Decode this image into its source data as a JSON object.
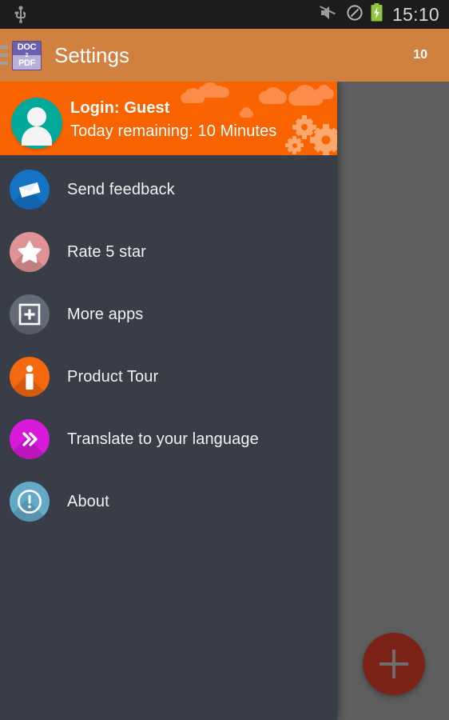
{
  "status_bar": {
    "usb_icon": "usb-icon",
    "mute_icon": "volume-muted-icon",
    "dnd_icon": "do-not-disturb-icon",
    "battery_icon": "battery-charging-icon",
    "clock": "15:10",
    "background": "#1c1c1c",
    "text_color": "#d8d8d8"
  },
  "action_bar": {
    "drawer_toggle_icon": "hamburger-menu-icon",
    "app_icon": {
      "name": "doc2pdf-app-icon",
      "line1": "DOC",
      "line2": "2",
      "line3": "PDF"
    },
    "title": "Settings",
    "count": "10",
    "background": "#d1813f"
  },
  "drawer": {
    "background": "#383d47",
    "header": {
      "background": "#fa6400",
      "avatar_icon": "user-avatar-icon",
      "avatar_background": "#00a99a",
      "login_label": "Login: Guest",
      "remaining_label": "Today remaining: 10 Minutes",
      "cloud_decoration": "cloud-icon",
      "gear_decoration": "gear-icon"
    },
    "items": [
      {
        "label": "Send feedback",
        "icon": "envelope-icon",
        "color": "#1573c6"
      },
      {
        "label": "Rate 5 star",
        "icon": "star-icon",
        "color": "#e09294"
      },
      {
        "label": "More apps",
        "icon": "plus-square-icon",
        "color": "#646a78"
      },
      {
        "label": "Product Tour",
        "icon": "person-standing-icon",
        "color": "#f4690f"
      },
      {
        "label": "Translate to your language",
        "icon": "double-chevron-icon",
        "color": "#d919d9"
      },
      {
        "label": "About",
        "icon": "info-exclamation-icon",
        "color": "#63a9c8"
      }
    ]
  },
  "content": {
    "scrim_color": "#5e5e5e",
    "fab": {
      "icon": "plus-icon",
      "color": "#7c2317"
    }
  }
}
